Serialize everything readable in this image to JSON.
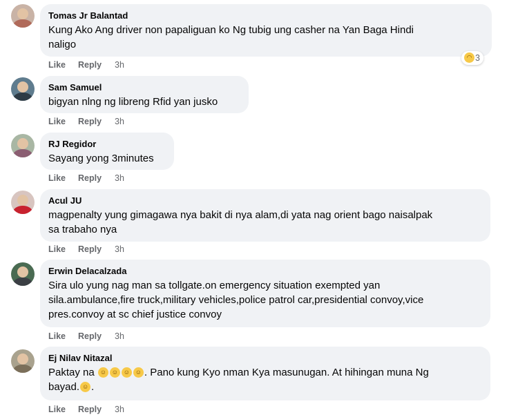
{
  "comments": [
    {
      "name": "Tomas Jr Balantad",
      "text": "Kung Ako Ang driver non papaliguan ko Ng tubig ung casher na Yan Baga Hindi\nnaligo",
      "like": "Like",
      "reply": "Reply",
      "time": "3h",
      "reaction": {
        "icon": "haha-emoji-icon",
        "count": "3"
      }
    },
    {
      "name": "Sam Samuel",
      "text": "bigyan nlng ng libreng Rfid yan jusko",
      "like": "Like",
      "reply": "Reply",
      "time": "3h"
    },
    {
      "name": "RJ Regidor",
      "text": "Sayang yong 3minutes",
      "like": "Like",
      "reply": "Reply",
      "time": "3h"
    },
    {
      "name": "Acul JU",
      "text": "magpenalty yung gimagawa nya bakit di nya alam,di yata nag orient bago naisalpak\nsa trabaho nya",
      "like": "Like",
      "reply": "Reply",
      "time": "3h"
    },
    {
      "name": "Erwin Delacalzada",
      "text": "Sira ulo yung nag man sa tollgate.on emergency situation exempted yan\nsila.ambulance,fire truck,military vehicles,police patrol car,presidential convoy,vice\npres.convoy at sc chief justice convoy",
      "like": "Like",
      "reply": "Reply",
      "time": "3h"
    },
    {
      "name": "Ej Nilav Nitazal",
      "text_before": "Paktay na ",
      "text_after": ". Pano kung Kyo nman Kya masunugan. At hihingan muna Ng",
      "text_line2": "bayad.",
      "text_line2_after": ".",
      "inline_emoji": "grinning-emoji-icon",
      "like": "Like",
      "reply": "Reply",
      "time": "3h"
    }
  ],
  "colors": {
    "bubble": "#f0f2f5",
    "meta": "#65676b",
    "text": "#050505",
    "emoji": "#f7c948"
  }
}
